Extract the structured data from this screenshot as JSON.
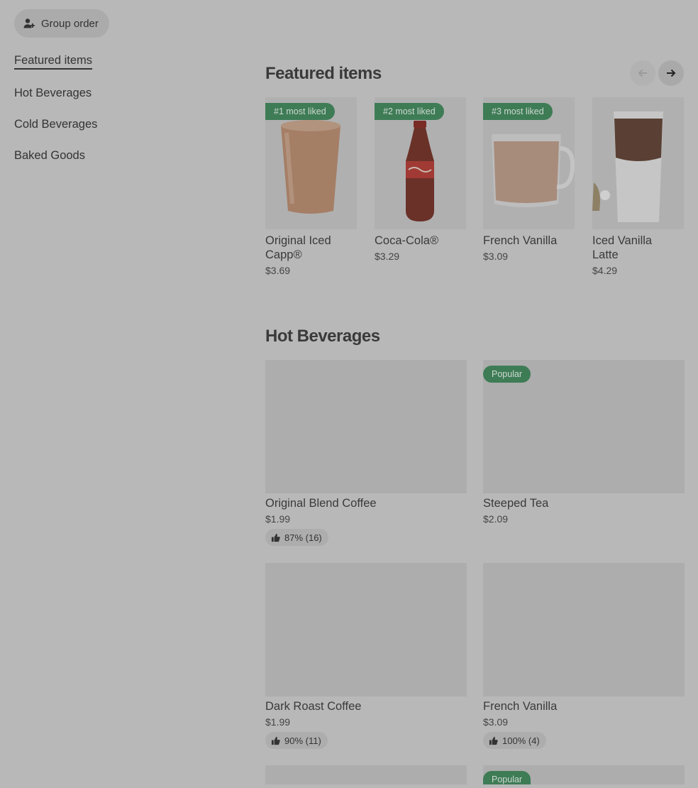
{
  "sidebar": {
    "group_order_label": "Group order",
    "items": [
      {
        "label": "Featured items"
      },
      {
        "label": "Hot Beverages"
      },
      {
        "label": "Cold Beverages"
      },
      {
        "label": "Baked Goods"
      }
    ]
  },
  "featured": {
    "title": "Featured items",
    "items": [
      {
        "badge": "#1 most liked",
        "name_line1": "Original Iced",
        "name_line2": "Capp®",
        "price": "$3.69"
      },
      {
        "badge": "#2 most liked",
        "name_line1": "Coca-Cola®",
        "name_line2": "",
        "price": "$3.29"
      },
      {
        "badge": "#3 most liked",
        "name_line1": "French Vanilla",
        "name_line2": "",
        "price": "$3.09"
      },
      {
        "badge": "",
        "name_line1": "Iced Vanilla",
        "name_line2": "Latte",
        "price": "$4.29"
      }
    ]
  },
  "hot": {
    "title": "Hot Beverages",
    "items": [
      {
        "name": "Original Blend Coffee",
        "price": "$1.99",
        "rating": "87% (16)",
        "badge": ""
      },
      {
        "name": "Steeped Tea",
        "price": "$2.09",
        "rating": "",
        "badge": "Popular"
      },
      {
        "name": "Dark Roast Coffee",
        "price": "$1.99",
        "rating": "90% (11)",
        "badge": ""
      },
      {
        "name": "French Vanilla",
        "price": "$3.09",
        "rating": "100% (4)",
        "badge": ""
      },
      {
        "name": "",
        "price": "",
        "rating": "",
        "badge": ""
      },
      {
        "name": "",
        "price": "",
        "rating": "",
        "badge": "Popular"
      }
    ]
  },
  "colors": {
    "badge_green": "#3e7c56",
    "overlay_gray": "#b8b8b8"
  }
}
